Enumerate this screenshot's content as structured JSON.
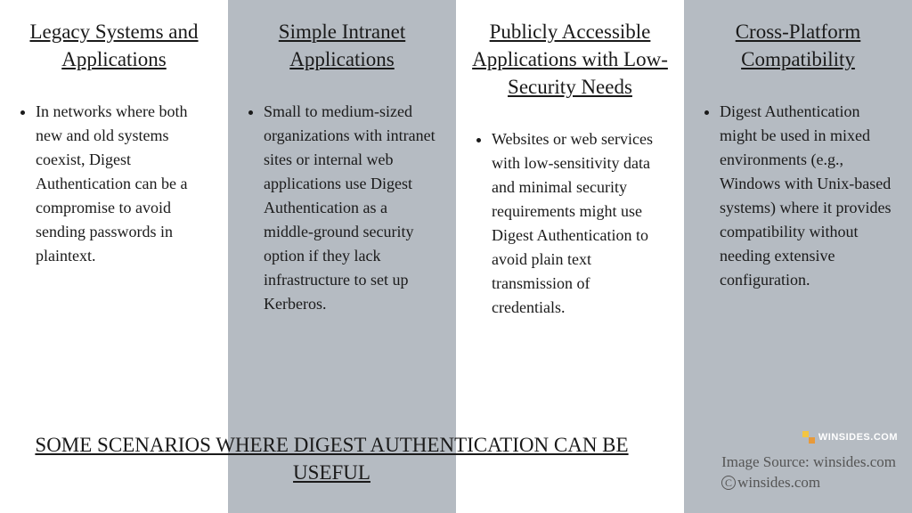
{
  "columns": [
    {
      "title": "Legacy Systems and Applications",
      "body": "In networks where both new and old systems coexist, Digest Authentication can be a compromise to avoid sending passwords in plaintext."
    },
    {
      "title": "Simple Intranet Applications",
      "body": "Small to medium-sized organizations with intranet sites or internal web applications use Digest Authentication as a middle-ground security option if they lack infrastructure to set up Kerberos."
    },
    {
      "title": "Publicly Accessible Applications with Low-Security Needs",
      "body": "Websites or web services with low-sensitivity data and minimal security requirements might use Digest Authentication to avoid plain text transmission of credentials."
    },
    {
      "title": "Cross-Platform Compatibility",
      "body": "Digest Authentication might be used in mixed environments (e.g., Windows with Unix-based systems) where it provides compatibility without needing extensive configuration."
    }
  ],
  "footer_title": "SOME SCENARIOS WHERE DIGEST AUTHENTICATION CAN BE USEFUL",
  "image_source": "Image Source: winsides.com",
  "copyright": "winsides.com",
  "badge_text": "WINSIDES.COM"
}
